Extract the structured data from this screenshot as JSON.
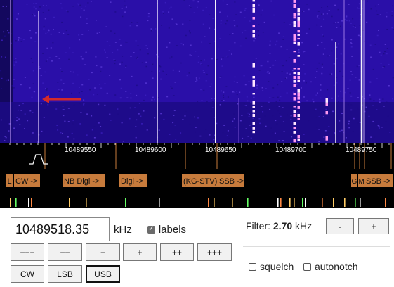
{
  "scale": {
    "ticks": [
      "10489550",
      "10489600",
      "10489650",
      "10489700",
      "10489750"
    ],
    "band_labels": [
      "L",
      "CW ->",
      "NB Digi ->",
      "Digi ->",
      "(KG-STV)",
      "SSB ->",
      "G",
      "M",
      "SSB ->"
    ]
  },
  "frequency": {
    "value": "10489518.35",
    "unit": "kHz"
  },
  "labels_toggle": {
    "label": "labels",
    "checked": true
  },
  "tuning": [
    "−−−",
    "−−",
    "−",
    "+",
    "++",
    "+++"
  ],
  "modes": [
    {
      "label": "CW",
      "selected": false
    },
    {
      "label": "LSB",
      "selected": false
    },
    {
      "label": "USB",
      "selected": true
    }
  ],
  "filter": {
    "label": "Filter:",
    "value": "2.70",
    "unit": "kHz",
    "minus": "-",
    "plus": "+"
  },
  "options": [
    {
      "label": "squelch",
      "checked": false
    },
    {
      "label": "autonotch",
      "checked": false
    }
  ],
  "colors": {
    "waterfall_bg": "#2a0fa8",
    "tag_bg": "#c77b3c",
    "marker_arrow": "#d42a2a"
  }
}
